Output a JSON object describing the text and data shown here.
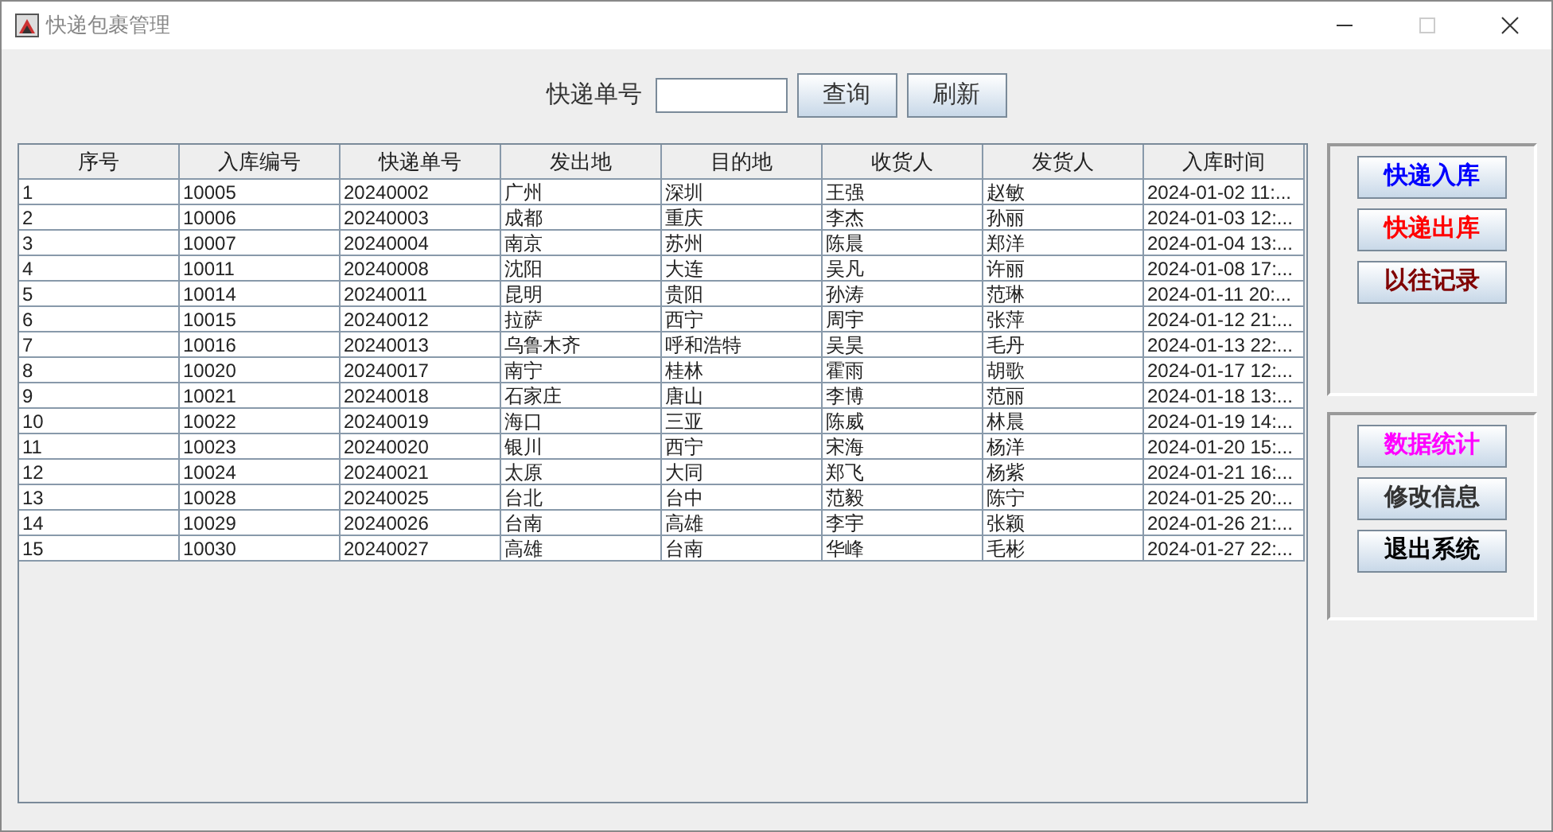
{
  "window": {
    "title": "快递包裹管理"
  },
  "search": {
    "label": "快递单号",
    "buttons": [
      "查询",
      "刷新"
    ]
  },
  "table": {
    "columns": [
      "序号",
      "入库编号",
      "快递单号",
      "发出地",
      "目的地",
      "收货人",
      "发货人",
      "入库时间"
    ],
    "rows": [
      [
        "1",
        "10005",
        "20240002",
        "广州",
        "深圳",
        "王强",
        "赵敏",
        "2024-01-02 11:..."
      ],
      [
        "2",
        "10006",
        "20240003",
        "成都",
        "重庆",
        "李杰",
        "孙丽",
        "2024-01-03 12:..."
      ],
      [
        "3",
        "10007",
        "20240004",
        "南京",
        "苏州",
        "陈晨",
        "郑洋",
        "2024-01-04 13:..."
      ],
      [
        "4",
        "10011",
        "20240008",
        "沈阳",
        "大连",
        "吴凡",
        "许丽",
        "2024-01-08 17:..."
      ],
      [
        "5",
        "10014",
        "20240011",
        "昆明",
        "贵阳",
        "孙涛",
        "范琳",
        "2024-01-11 20:..."
      ],
      [
        "6",
        "10015",
        "20240012",
        "拉萨",
        "西宁",
        "周宇",
        "张萍",
        "2024-01-12 21:..."
      ],
      [
        "7",
        "10016",
        "20240013",
        "乌鲁木齐",
        "呼和浩特",
        "吴昊",
        "毛丹",
        "2024-01-13 22:..."
      ],
      [
        "8",
        "10020",
        "20240017",
        "南宁",
        "桂林",
        "霍雨",
        "胡歌",
        "2024-01-17 12:..."
      ],
      [
        "9",
        "10021",
        "20240018",
        "石家庄",
        "唐山",
        "李博",
        "范丽",
        "2024-01-18 13:..."
      ],
      [
        "10",
        "10022",
        "20240019",
        "海口",
        "三亚",
        "陈威",
        "林晨",
        "2024-01-19 14:..."
      ],
      [
        "11",
        "10023",
        "20240020",
        "银川",
        "西宁",
        "宋海",
        "杨洋",
        "2024-01-20 15:..."
      ],
      [
        "12",
        "10024",
        "20240021",
        "太原",
        "大同",
        "郑飞",
        "杨紫",
        "2024-01-21 16:..."
      ],
      [
        "13",
        "10028",
        "20240025",
        "台北",
        "台中",
        "范毅",
        "陈宁",
        "2024-01-25 20:..."
      ],
      [
        "14",
        "10029",
        "20240026",
        "台南",
        "高雄",
        "李宇",
        "张颖",
        "2024-01-26 21:..."
      ],
      [
        "15",
        "10030",
        "20240027",
        "高雄",
        "台南",
        "华峰",
        "毛彬",
        "2024-01-27 22:..."
      ]
    ]
  },
  "panels": [
    {
      "buttons": [
        {
          "label": "快递入库",
          "color": "#0000ff"
        },
        {
          "label": "快递出库",
          "color": "#ff0000"
        },
        {
          "label": "以往记录",
          "color": "#800000"
        }
      ]
    },
    {
      "buttons": [
        {
          "label": "数据统计",
          "color": "#ff00ff"
        },
        {
          "label": "修改信息",
          "color": "#333333"
        },
        {
          "label": "退出系统",
          "color": "#000000"
        }
      ]
    }
  ]
}
